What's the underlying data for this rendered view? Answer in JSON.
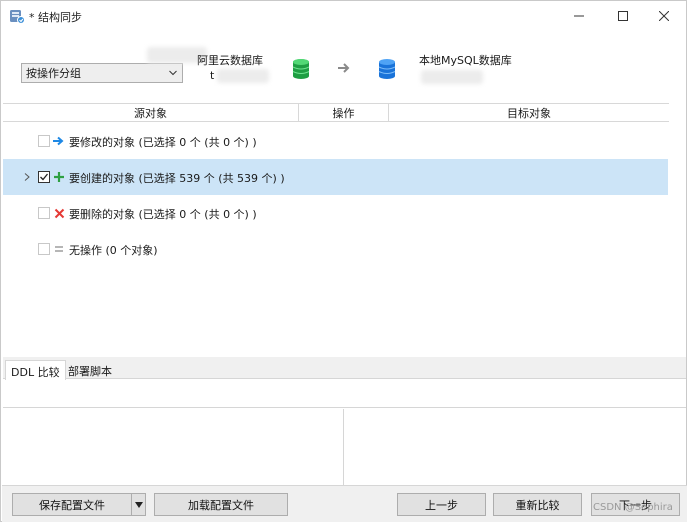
{
  "window": {
    "title": "* 结构同步",
    "controls": {
      "minimize": "—",
      "maximize": "☐",
      "close": "✕"
    }
  },
  "header": {
    "group_select_value": "按操作分组",
    "source_label": "阿里云数据库",
    "source_sub": "t",
    "target_label": "本地MySQL数据库",
    "icons": {
      "source_db": "green-database-icon",
      "arrow": "right-arrow-icon",
      "target_db": "blue-database-icon"
    }
  },
  "grid": {
    "columns": [
      "源对象",
      "操作",
      "目标对象"
    ],
    "rows": [
      {
        "text": "要修改的对象 (已选择 0 个 (共 0 个) )",
        "icon": "modify-arrow-icon",
        "checked": false,
        "selected": false,
        "expandable": false
      },
      {
        "text": "要创建的对象 (已选择 539 个 (共 539 个) )",
        "icon": "create-plus-icon",
        "checked": true,
        "selected": true,
        "expandable": true
      },
      {
        "text": "要删除的对象 (已选择 0 个 (共 0 个) )",
        "icon": "delete-x-icon",
        "checked": false,
        "selected": false,
        "expandable": false
      },
      {
        "text": "无操作 (0 个对象)",
        "icon": "no-op-equals-icon",
        "checked": false,
        "selected": false,
        "expandable": false
      }
    ]
  },
  "bottom_tabs": [
    "DDL 比较",
    "部署脚本"
  ],
  "footer": {
    "save_config": "保存配置文件",
    "load_config": "加载配置文件",
    "prev": "上一步",
    "recompare": "重新比较",
    "next": "下一步"
  },
  "watermark": "CSDN @Sephira"
}
